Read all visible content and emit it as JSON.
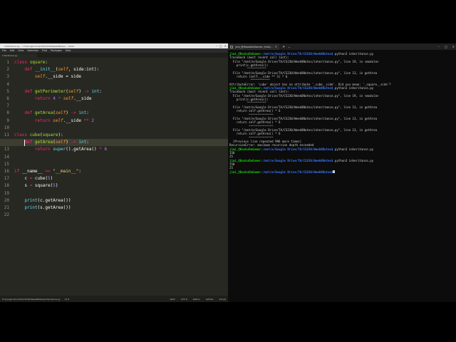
{
  "editor": {
    "title": "inheritance.py — H:\\Google Drive\\TA\\CS230\\Week6Notes — Atom",
    "window_controls": [
      "–",
      "□",
      "×"
    ],
    "menu": [
      "File",
      "Edit",
      "View",
      "Selection",
      "Find",
      "Packages",
      "Help"
    ],
    "tab_label": "inheritance.py",
    "active_line": 12,
    "lines": [
      [
        [
          "kw",
          "class "
        ],
        [
          "fn",
          "square"
        ],
        [
          "plain",
          ":"
        ]
      ],
      [
        [
          "plain",
          "    "
        ],
        [
          "kw",
          "def "
        ],
        [
          "bi",
          "__init__"
        ],
        [
          "plain",
          "("
        ],
        [
          "slf",
          "self"
        ],
        [
          "plain",
          ", side:int):"
        ]
      ],
      [
        [
          "plain",
          "        "
        ],
        [
          "slf",
          "self"
        ],
        [
          "plain",
          ".__side = side"
        ]
      ],
      [],
      [
        [
          "plain",
          "    "
        ],
        [
          "kw",
          "def "
        ],
        [
          "fn",
          "getPerimeter"
        ],
        [
          "plain",
          "("
        ],
        [
          "slf",
          "self"
        ],
        [
          "plain",
          ") "
        ],
        [
          "kw",
          "->"
        ],
        [
          "plain",
          " "
        ],
        [
          "bi",
          "int"
        ],
        [
          "plain",
          ":"
        ]
      ],
      [
        [
          "plain",
          "        "
        ],
        [
          "kw",
          "return "
        ],
        [
          "num",
          "4"
        ],
        [
          "plain",
          " "
        ],
        [
          "kw",
          "*"
        ],
        [
          "plain",
          " "
        ],
        [
          "slf",
          "self"
        ],
        [
          "plain",
          ".__side"
        ]
      ],
      [],
      [
        [
          "plain",
          "    "
        ],
        [
          "kw",
          "def "
        ],
        [
          "fn",
          "getArea"
        ],
        [
          "plain",
          "("
        ],
        [
          "slf",
          "self"
        ],
        [
          "plain",
          ") "
        ],
        [
          "kw",
          "->"
        ],
        [
          "plain",
          " "
        ],
        [
          "bi",
          "int"
        ],
        [
          "plain",
          ":"
        ]
      ],
      [
        [
          "plain",
          "        "
        ],
        [
          "kw",
          "return "
        ],
        [
          "slf",
          "self"
        ],
        [
          "plain",
          ".__side "
        ],
        [
          "kw",
          "**"
        ],
        [
          "plain",
          " "
        ],
        [
          "num",
          "2"
        ]
      ],
      [],
      [
        [
          "kw",
          "class "
        ],
        [
          "fn",
          "cube"
        ],
        [
          "plain",
          "("
        ],
        [
          "fn",
          "square"
        ],
        [
          "plain",
          "):"
        ]
      ],
      [
        [
          "plain",
          "    "
        ],
        [
          "kw",
          "def "
        ],
        [
          "fn",
          "getArea"
        ],
        [
          "plain",
          "("
        ],
        [
          "slf",
          "self"
        ],
        [
          "plain",
          ") "
        ],
        [
          "kw",
          "->"
        ],
        [
          "plain",
          " "
        ],
        [
          "bi",
          "int"
        ],
        [
          "plain",
          ":"
        ]
      ],
      [
        [
          "plain",
          "        "
        ],
        [
          "kw",
          "return "
        ],
        [
          "bi",
          "super"
        ],
        [
          "plain",
          "().getArea() "
        ],
        [
          "kw",
          "*"
        ],
        [
          "plain",
          " "
        ],
        [
          "num",
          "6"
        ]
      ],
      [],
      [],
      [
        [
          "kw",
          "if "
        ],
        [
          "plain",
          "__name__ "
        ],
        [
          "kw",
          "=="
        ],
        [
          "plain",
          " "
        ],
        [
          "str",
          "\"__main__\""
        ],
        [
          "plain",
          ":"
        ]
      ],
      [
        [
          "plain",
          "    c "
        ],
        [
          "kw",
          "="
        ],
        [
          "plain",
          " cube("
        ],
        [
          "num",
          "5"
        ],
        [
          "plain",
          ")"
        ]
      ],
      [
        [
          "plain",
          "    s "
        ],
        [
          "kw",
          "="
        ],
        [
          "plain",
          " square("
        ],
        [
          "num",
          "5"
        ],
        [
          "plain",
          ")"
        ]
      ],
      [],
      [
        [
          "plain",
          "    "
        ],
        [
          "bi",
          "print"
        ],
        [
          "plain",
          "(c.getArea())"
        ]
      ],
      [
        [
          "plain",
          "    "
        ],
        [
          "bi",
          "print"
        ],
        [
          "plain",
          "(s.getArea())"
        ]
      ],
      []
    ],
    "status_left": "H:\\Google Drive\\TA\\CS230\\Week6Notes\\inheritance.py",
    "status_pos": "12:5",
    "status_right": [
      "CRLF",
      "UTF-8",
      "Python",
      "GitHub",
      "Git (0)"
    ]
  },
  "terminal": {
    "tab_title": "jimi_@HaskoDeGamer: /mnt/...",
    "window_controls": [
      "–",
      "□",
      "×"
    ],
    "prompt_user": "jimi_@HaskoDeGamer",
    "prompt_path": ":/mnt/e/Google Drive/TA/CS230/Week6Notes$",
    "lines": [
      {
        "t": "prompt",
        "cmd": " python3 inheritance.py"
      },
      {
        "t": "text",
        "v": "Traceback (most recent call last):"
      },
      {
        "t": "text",
        "v": "  File \"/mnt/e/Google Drive/TA/CS230/Week6Notes/inheritance.py\", line 19, in <module>"
      },
      {
        "t": "text",
        "v": "    print(c.getArea())"
      },
      {
        "t": "text",
        "v": "          ^^^^^^^^^^^"
      },
      {
        "t": "text",
        "v": "  File \"/mnt/e/Google Drive/TA/CS230/Week6Notes/inheritance.py\", line 13, in getArea"
      },
      {
        "t": "text",
        "v": "    return (self.__side ** 3) * 6"
      },
      {
        "t": "text",
        "v": "            ^^^^^^^^^^^"
      },
      {
        "t": "text",
        "v": "AttributeError: 'cube' object has no attribute '_cube__side'. Did you mean: '_square__side'?"
      },
      {
        "t": "prompt",
        "cmd": " python3 inheritance.py"
      },
      {
        "t": "text",
        "v": "Traceback (most recent call last):"
      },
      {
        "t": "text",
        "v": "  File \"/mnt/e/Google Drive/TA/CS230/Week6Notes/inheritance.py\", line 19, in <module>"
      },
      {
        "t": "text",
        "v": "    print(c.getArea())"
      },
      {
        "t": "text",
        "v": "          ^^^^^^^^^^^"
      },
      {
        "t": "text",
        "v": "  File \"/mnt/e/Google Drive/TA/CS230/Week6Notes/inheritance.py\", line 13, in getArea"
      },
      {
        "t": "text",
        "v": "    return self.getArea() * 6"
      },
      {
        "t": "text",
        "v": "           ^^^^^^^^^^^^^^"
      },
      {
        "t": "text",
        "v": "  File \"/mnt/e/Google Drive/TA/CS230/Week6Notes/inheritance.py\", line 13, in getArea"
      },
      {
        "t": "text",
        "v": "    return self.getArea() * 6"
      },
      {
        "t": "text",
        "v": "           ^^^^^^^^^^^^^^"
      },
      {
        "t": "text",
        "v": "  File \"/mnt/e/Google Drive/TA/CS230/Week6Notes/inheritance.py\", line 13, in getArea"
      },
      {
        "t": "text",
        "v": "    return self.getArea() * 6"
      },
      {
        "t": "text",
        "v": "           ^^^^^^^^^^^^^^"
      },
      {
        "t": "text",
        "v": "  [Previous line repeated 996 more times]"
      },
      {
        "t": "text",
        "v": "RecursionError: maximum recursion depth exceeded"
      },
      {
        "t": "prompt",
        "cmd": " python3 inheritance.py"
      },
      {
        "t": "text",
        "v": "150"
      },
      {
        "t": "text",
        "v": "25"
      },
      {
        "t": "prompt",
        "cmd": " python3 inheritance.py"
      },
      {
        "t": "text",
        "v": "150"
      },
      {
        "t": "text",
        "v": "25"
      },
      {
        "t": "prompt",
        "cmd": "",
        "cursor": true
      }
    ]
  },
  "colors": {
    "editor_bg": "#272822",
    "terminal_bg": "#0c0c0c",
    "prompt_user": "#16c60c",
    "prompt_path": "#3b78ff"
  }
}
